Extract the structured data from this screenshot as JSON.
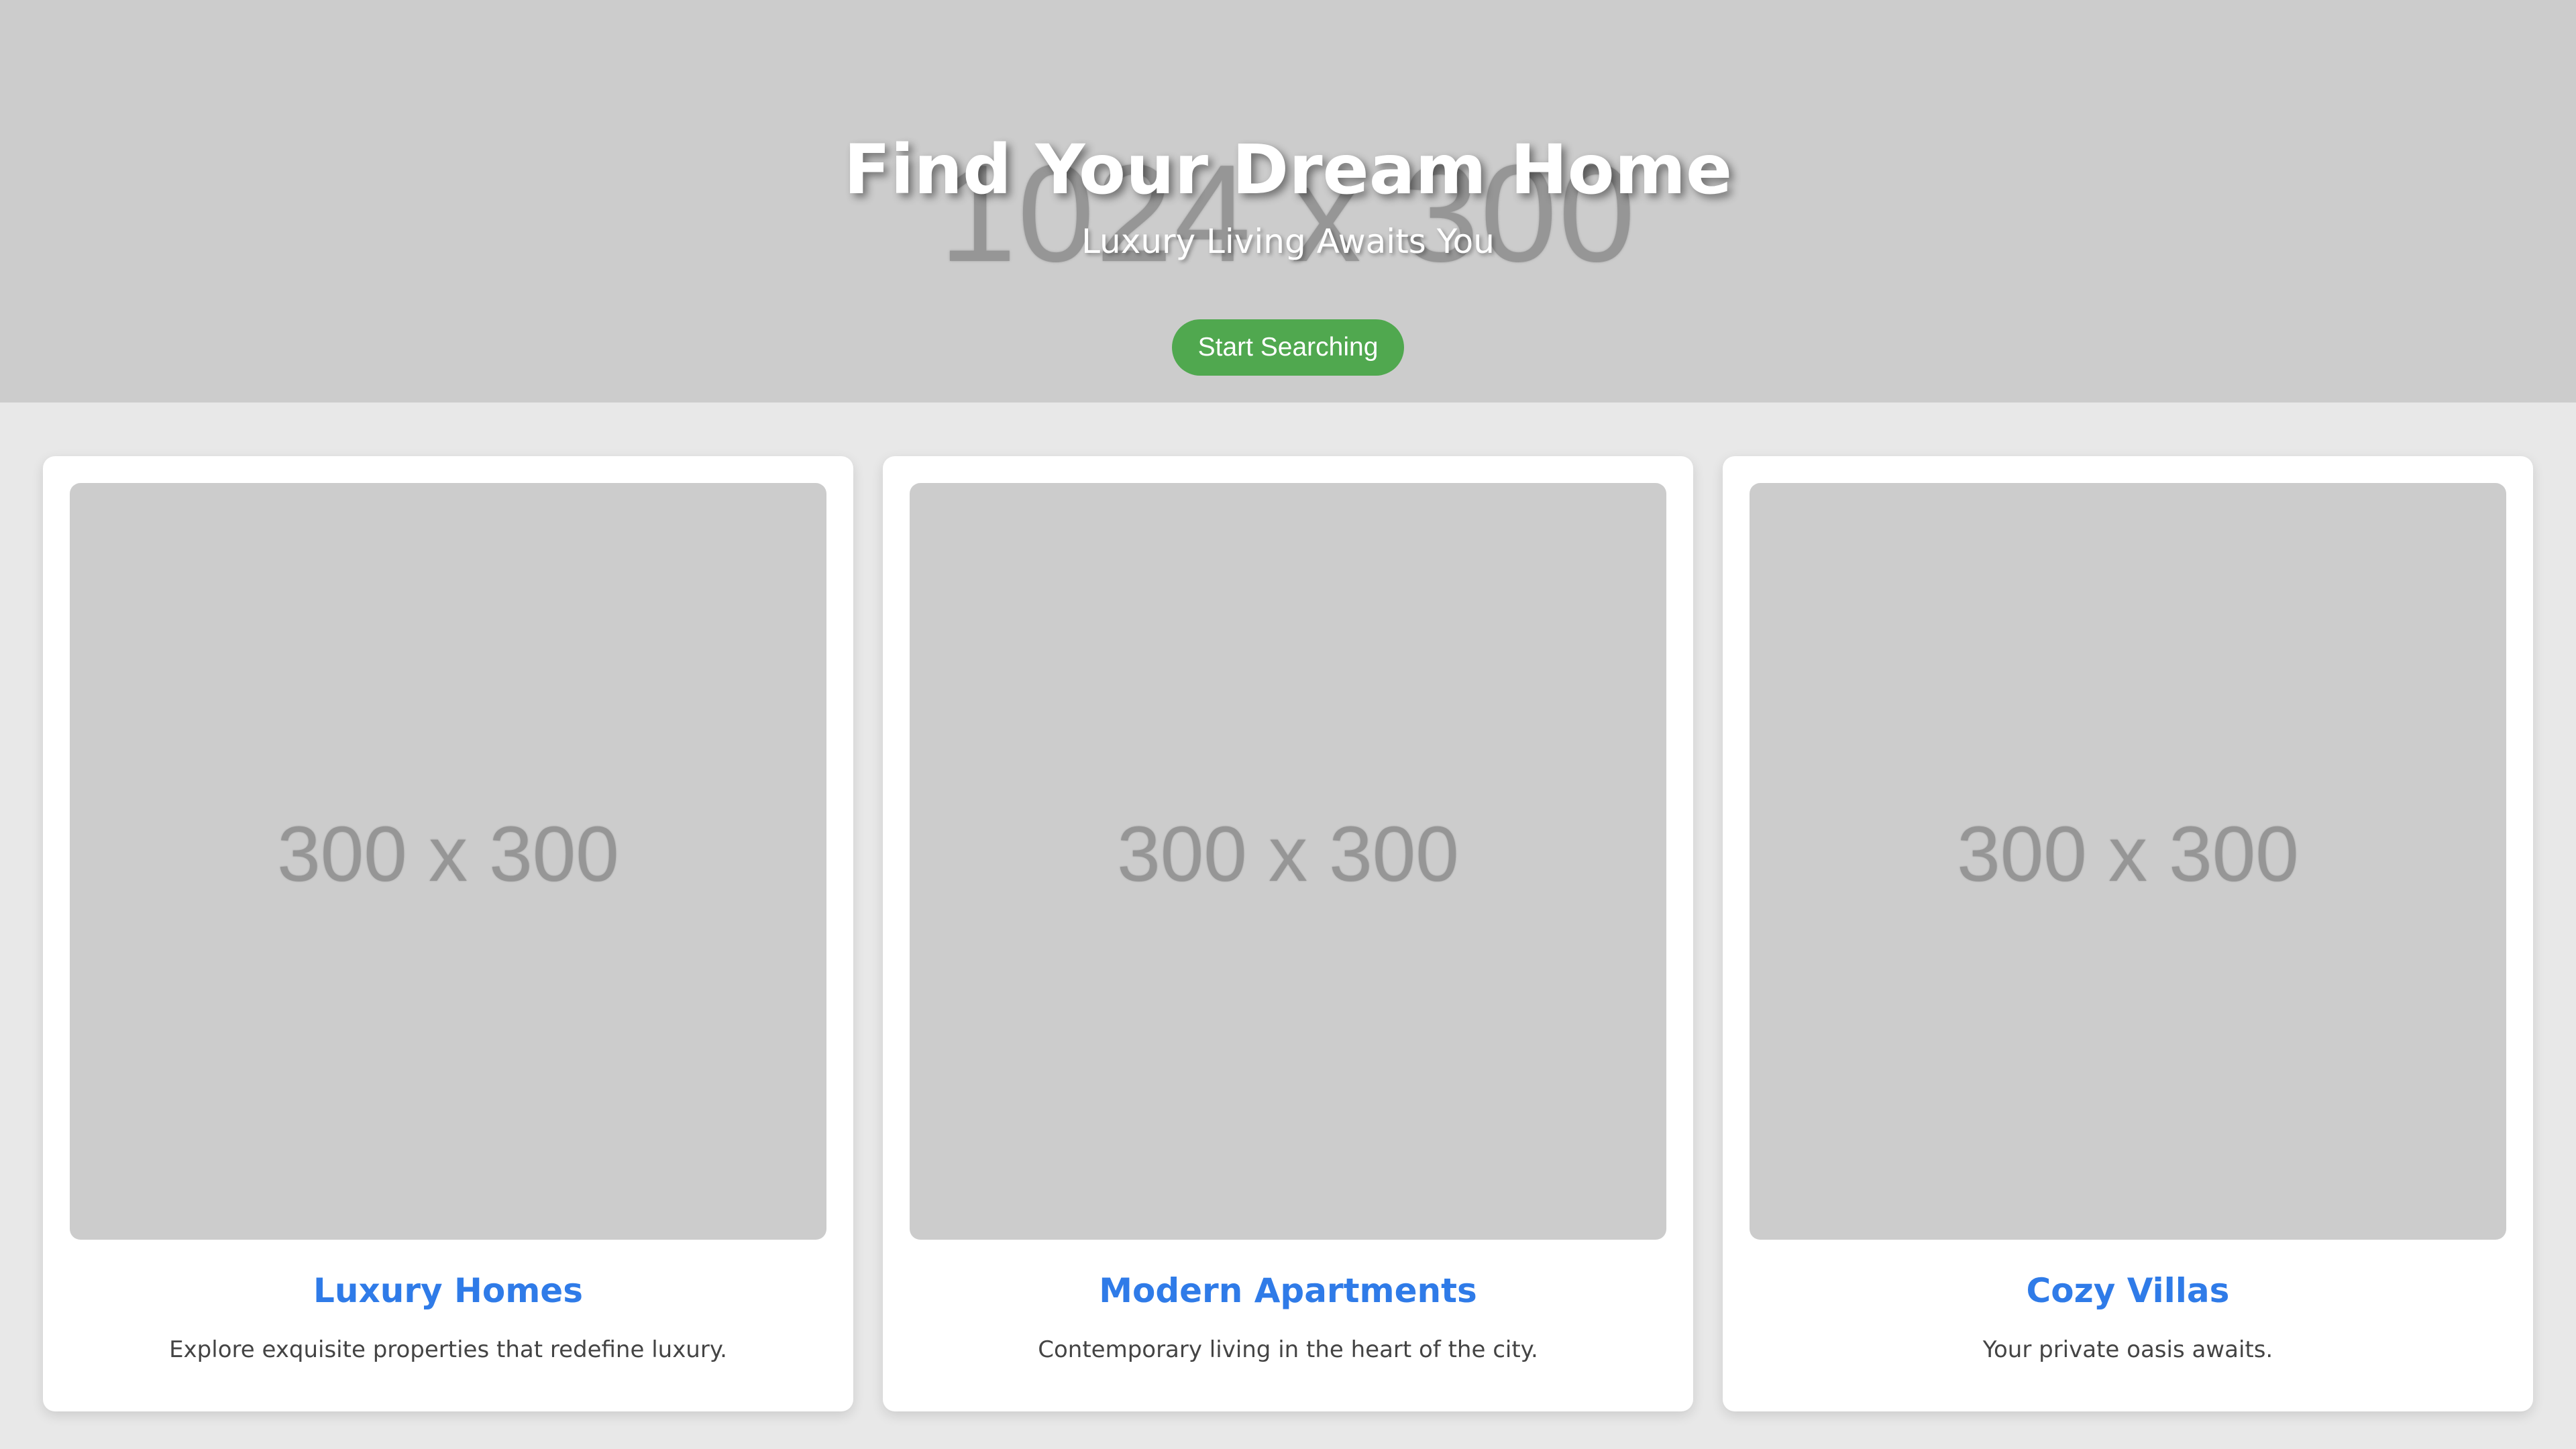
{
  "hero": {
    "placeholder": "1024 x 300",
    "title": "Find Your Dream Home",
    "subtitle": "Luxury Living Awaits You",
    "button_label": "Start Searching",
    "button_color": "#50a84f",
    "background_color": "#cccccc"
  },
  "cards": [
    {
      "image_label": "300 x 300",
      "title": "Luxury Homes",
      "description": "Explore exquisite properties that redefine luxury."
    },
    {
      "image_label": "300 x 300",
      "title": "Modern Apartments",
      "description": "Contemporary living in the heart of the city."
    },
    {
      "image_label": "300 x 300",
      "title": "Cozy Villas",
      "description": "Your private oasis awaits."
    }
  ],
  "colors": {
    "card_title": "#2f7be8",
    "page_background": "#e8e8e8"
  }
}
